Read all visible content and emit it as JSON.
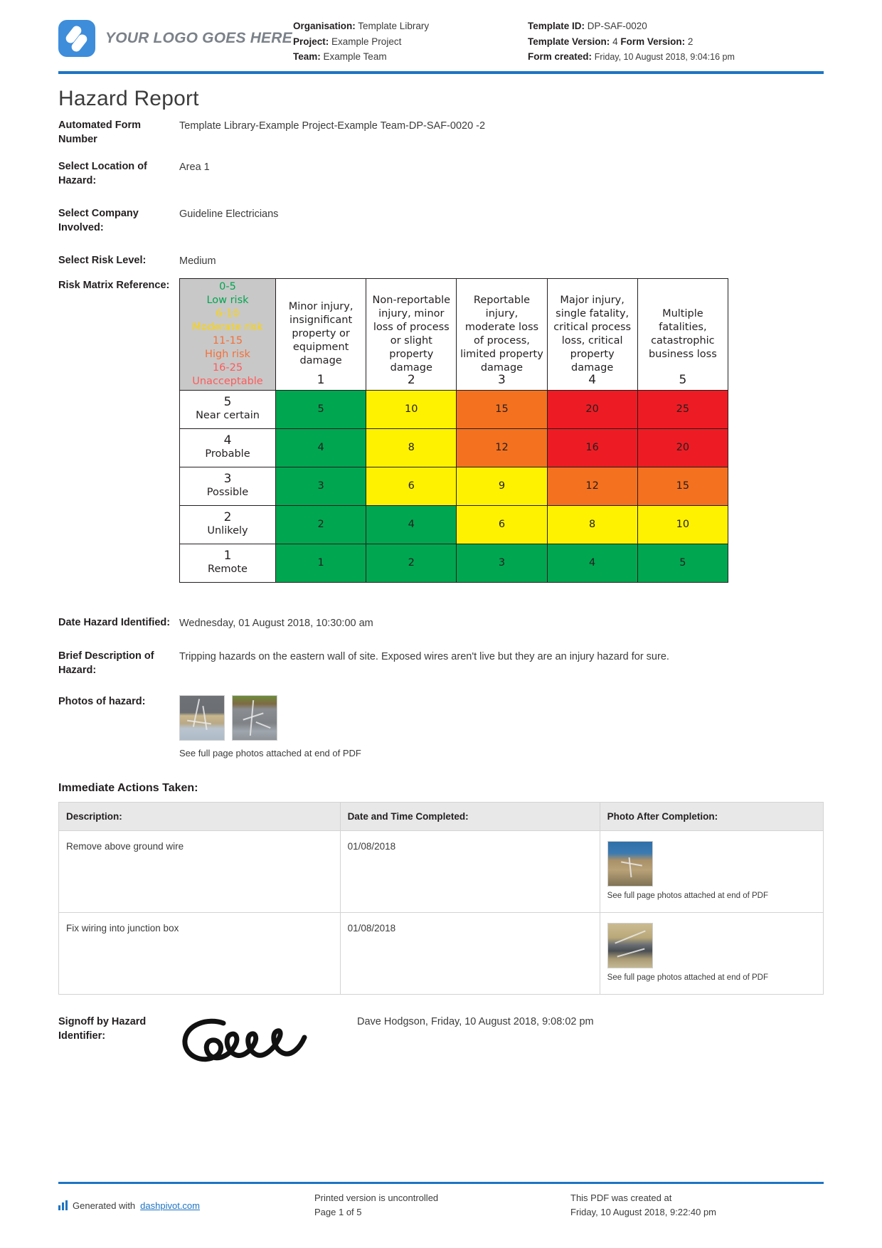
{
  "header": {
    "logo_text": "YOUR LOGO GOES HERE",
    "left_meta": [
      {
        "label": "Organisation:",
        "value": "Template Library"
      },
      {
        "label": "Project:",
        "value": "Example Project"
      },
      {
        "label": "Team:",
        "value": "Example Team"
      }
    ],
    "right_meta": {
      "template_id_label": "Template ID:",
      "template_id_value": "DP-SAF-0020",
      "template_version_label": "Template Version:",
      "template_version_value": "4",
      "form_version_label": "Form Version:",
      "form_version_value": "2",
      "form_created_label": "Form created:",
      "form_created_value": "Friday, 10 August 2018, 9:04:16 pm"
    },
    "accent_color": "#1d74c4"
  },
  "title": "Hazard Report",
  "fields": [
    {
      "label": "Automated Form Number",
      "value": "Template Library-Example Project-Example Team-DP-SAF-0020   -2"
    },
    {
      "label": "Select Location of Hazard:",
      "value": "Area 1"
    },
    {
      "label": "Select Company Involved:",
      "value": "Guideline Electricians"
    },
    {
      "label": "Select Risk Level:",
      "value": "Medium"
    }
  ],
  "risk_matrix": {
    "label": "Risk Matrix Reference:",
    "legend": [
      {
        "range": "0-5",
        "text": "Low risk",
        "color": "#00a650"
      },
      {
        "range": "6-10",
        "text": "Moderate risk",
        "color": "#ffd400"
      },
      {
        "range": "11-15",
        "text": "High risk",
        "color": "#f3703a"
      },
      {
        "range": "16-25",
        "text": "Unacceptable",
        "color": "#ff5a5a"
      }
    ],
    "columns": [
      {
        "desc": "Minor injury, insignificant property or equipment damage",
        "num": "1"
      },
      {
        "desc": "Non-reportable injury, minor loss of process or slight property damage",
        "num": "2"
      },
      {
        "desc": "Reportable injury, moderate loss of process, limited property damage",
        "num": "3"
      },
      {
        "desc": "Major injury, single fatality, critical process loss, critical property damage",
        "num": "4"
      },
      {
        "desc": "Multiple fatalities, catastrophic business loss",
        "num": "5"
      }
    ],
    "rows": [
      {
        "num": "5",
        "label": "Near certain",
        "cells": [
          {
            "value": "5",
            "color": "green"
          },
          {
            "value": "10",
            "color": "yellow"
          },
          {
            "value": "15",
            "color": "orange"
          },
          {
            "value": "20",
            "color": "red"
          },
          {
            "value": "25",
            "color": "red"
          }
        ]
      },
      {
        "num": "4",
        "label": "Probable",
        "cells": [
          {
            "value": "4",
            "color": "green"
          },
          {
            "value": "8",
            "color": "yellow"
          },
          {
            "value": "12",
            "color": "orange"
          },
          {
            "value": "16",
            "color": "red"
          },
          {
            "value": "20",
            "color": "red"
          }
        ]
      },
      {
        "num": "3",
        "label": "Possible",
        "cells": [
          {
            "value": "3",
            "color": "green"
          },
          {
            "value": "6",
            "color": "yellow"
          },
          {
            "value": "9",
            "color": "yellow"
          },
          {
            "value": "12",
            "color": "orange"
          },
          {
            "value": "15",
            "color": "orange"
          }
        ]
      },
      {
        "num": "2",
        "label": "Unlikely",
        "cells": [
          {
            "value": "2",
            "color": "green"
          },
          {
            "value": "4",
            "color": "green"
          },
          {
            "value": "6",
            "color": "yellow"
          },
          {
            "value": "8",
            "color": "yellow"
          },
          {
            "value": "10",
            "color": "yellow"
          }
        ]
      },
      {
        "num": "1",
        "label": "Remote",
        "cells": [
          {
            "value": "1",
            "color": "green"
          },
          {
            "value": "2",
            "color": "green"
          },
          {
            "value": "3",
            "color": "green"
          },
          {
            "value": "4",
            "color": "green"
          },
          {
            "value": "5",
            "color": "green"
          }
        ]
      }
    ],
    "cell_colors": {
      "green": "#00a650",
      "yellow": "#fff200",
      "orange": "#f4711f",
      "red": "#ed1c24"
    }
  },
  "date_hazard": {
    "label": "Date Hazard Identified:",
    "value": "Wednesday, 01 August 2018, 10:30:00 am"
  },
  "description": {
    "label": "Brief Description of Hazard:",
    "value": "Tripping hazards on the eastern wall of site. Exposed wires aren't live but they are an injury hazard for sure."
  },
  "photos": {
    "label": "Photos of hazard:",
    "caption": "See full page photos attached at end of PDF"
  },
  "actions": {
    "title": "Immediate Actions Taken:",
    "columns": [
      "Description:",
      "Date and Time Completed:",
      "Photo After Completion:"
    ],
    "rows": [
      {
        "description": "Remove above ground wire",
        "date": "01/08/2018",
        "photo_caption": "See full page photos attached at end of PDF"
      },
      {
        "description": "Fix wiring into junction box",
        "date": "01/08/2018",
        "photo_caption": "See full page photos attached at end of PDF"
      }
    ]
  },
  "signoff": {
    "label": "Signoff by Hazard Identifier:",
    "value": "Dave Hodgson, Friday, 10 August 2018, 9:08:02 pm"
  },
  "footer": {
    "generated_prefix": "Generated with ",
    "generated_link": "dashpivot.com",
    "uncontrolled": "Printed version is uncontrolled",
    "page": "Page 1 of 5",
    "created_at_label": "This PDF was created at",
    "created_at_value": "Friday, 10 August 2018, 9:22:40 pm"
  }
}
